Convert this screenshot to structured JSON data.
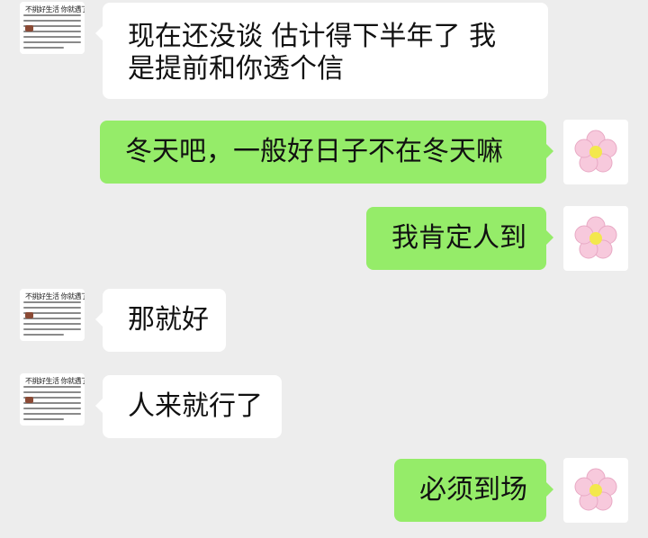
{
  "contact_avatar": {
    "title": "不挑好生活 你就遇了",
    "icon": "document-thumbnail"
  },
  "self_avatar": {
    "icon": "pink-flower-icon"
  },
  "messages": [
    {
      "side": "left",
      "text": "现在还没谈 估计得下半年了 我是提前和你透个信"
    },
    {
      "side": "right",
      "text": "冬天吧，一般好日子不在冬天嘛"
    },
    {
      "side": "right",
      "text": "我肯定人到"
    },
    {
      "side": "left",
      "text": "那就好"
    },
    {
      "side": "left",
      "text": "人来就行了"
    },
    {
      "side": "right",
      "text": "必须到场"
    }
  ],
  "colors": {
    "background": "#ededed",
    "incoming_bubble": "#ffffff",
    "outgoing_bubble": "#95ec69",
    "flower_petals": "#f7c9dc",
    "flower_center": "#f3e84c"
  }
}
